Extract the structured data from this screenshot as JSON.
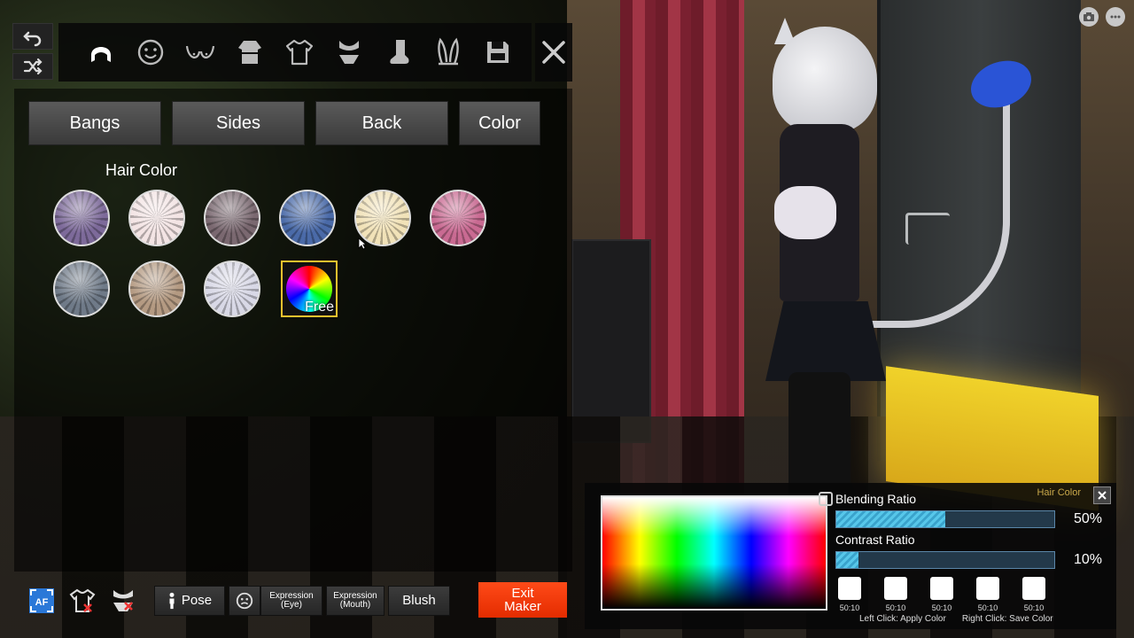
{
  "toolbar": {
    "categories": [
      "hair",
      "face",
      "body",
      "clothing-top",
      "clothing-shirt",
      "underwear",
      "socks",
      "accessories",
      "save"
    ]
  },
  "tabs": [
    {
      "label": "Bangs"
    },
    {
      "label": "Sides"
    },
    {
      "label": "Back"
    },
    {
      "label": "Color"
    }
  ],
  "section_title": "Hair Color",
  "swatches": [
    {
      "color": "#7d6a9a"
    },
    {
      "color": "#f3e4e4"
    },
    {
      "color": "#7a6870"
    },
    {
      "color": "#4a6aa8"
    },
    {
      "color": "#f1e2b8"
    },
    {
      "color": "#c96a92"
    },
    {
      "color": "#6f7a88"
    },
    {
      "color": "#b49a82"
    },
    {
      "color": "#d8d8e6"
    }
  ],
  "free_swatch_label": "Free",
  "bottombar": {
    "pose_label": "Pose",
    "expression_eye_label": "Expression (Eye)",
    "expression_mouth_line1": "Expression",
    "expression_mouth_line2": "(Mouth)",
    "blush_label": "Blush",
    "exit_line1": "Exit",
    "exit_line2": "Maker"
  },
  "picker": {
    "title": "Hair Color",
    "blending_label": "Blending Ratio",
    "blending_value": "50%",
    "blending_fraction": 0.5,
    "contrast_label": "Contrast Ratio",
    "contrast_value": "10%",
    "contrast_fraction": 0.1,
    "saved_slots": [
      "50:10",
      "50:10",
      "50:10",
      "50:10",
      "50:10"
    ],
    "hint_left": "Left Click: Apply Color",
    "hint_right": "Right Click: Save Color"
  },
  "colors": {
    "accent_orange": "#ff4a18",
    "selected_gold": "#f2c12e",
    "bar_fill": "#57c7ea"
  }
}
